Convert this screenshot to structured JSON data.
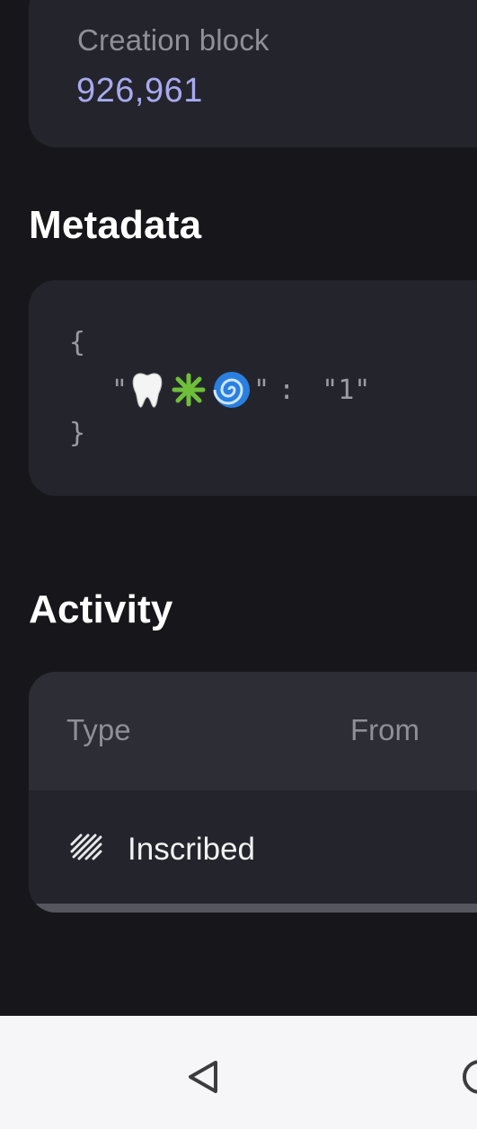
{
  "stats": {
    "creation_block_label": "Creation block",
    "creation_block_value": "926,961"
  },
  "metadata": {
    "title": "Metadata",
    "open_brace": "{",
    "close_brace": "}",
    "key_icons": [
      "tooth-icon",
      "sparkle-icon",
      "swirl-icon"
    ],
    "quote": "\"",
    "colon": ":",
    "value": "\"1\""
  },
  "activity": {
    "title": "Activity",
    "columns": [
      "Type",
      "From"
    ],
    "rows": [
      {
        "icon": "inscribe-hatch-icon",
        "type": "Inscribed"
      }
    ]
  },
  "colors": {
    "background": "#17171b",
    "card": "#24252c",
    "accent_value": "#a8a9f0",
    "muted_text": "#8e9099",
    "nav_bar": "#f6f6f8"
  },
  "nav": {
    "buttons": [
      "back-icon",
      "home-icon"
    ]
  }
}
